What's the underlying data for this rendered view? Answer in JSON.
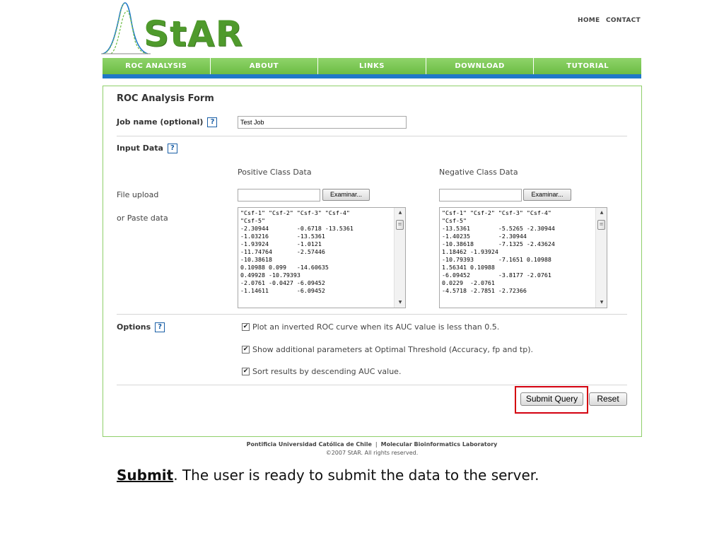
{
  "brand": {
    "logo_text": "StAR",
    "accent": "#6cbd44",
    "stripe": "#1f78c8"
  },
  "top_links": {
    "home": "HOME",
    "contact": "CONTACT"
  },
  "nav": [
    "ROC ANALYSIS",
    "ABOUT",
    "LINKS",
    "DOWNLOAD",
    "TUTORIAL"
  ],
  "form": {
    "title": "ROC Analysis Form",
    "job_name_label": "Job name (optional)",
    "job_name_value": "Test Job",
    "help_glyph": "?",
    "input_data_label": "Input Data",
    "positive_header": "Positive Class Data",
    "negative_header": "Negative Class Data",
    "file_upload_label": "File upload",
    "paste_label": "or Paste data",
    "browse_label": "Examinar...",
    "positive_paste": "\"Csf-1\" \"Csf-2\" \"Csf-3\" \"Csf-4\"\n\"Csf-5\"\n-2.30944        -0.6718 -13.5361\n-1.03216        -13.5361\n-1.93924        -1.0121\n-11.74764       -2.57446\n-10.38618\n0.10988 0.099   -14.60635\n0.49928 -10.79393\n-2.0761 -0.0427 -6.09452\n-1.14611        -6.09452",
    "negative_paste": "\"Csf-1\" \"Csf-2\" \"Csf-3\" \"Csf-4\"\n\"Csf-5\"\n-13.5361        -5.5265 -2.30944\n-1.40235        -2.30944\n-10.38618       -7.1325 -2.43624\n1.18462 -1.93924\n-10.79393       -7.1651 0.10988\n1.56341 0.10988\n-6.09452        -3.8177 -2.0761\n0.0229  -2.0761\n-4.5718 -2.7851 -2.72366",
    "options_label": "Options",
    "options": [
      {
        "label": "Plot an inverted ROC curve when its AUC value is less than 0.5.",
        "checked": true
      },
      {
        "label": "Show additional parameters at Optimal Threshold (Accuracy, fp and tp).",
        "checked": true
      },
      {
        "label": "Sort results by descending AUC value.",
        "checked": true
      }
    ],
    "check_glyph": "✔",
    "submit_label": "Submit Query",
    "reset_label": "Reset",
    "highlight_color": "#d4000f"
  },
  "footer": {
    "university": "Pontificia Universidad Católica de Chile",
    "separator": "|",
    "lab": "Molecular Bioinformatics Laboratory",
    "copyright": "©2007 StAR. All rights reserved."
  },
  "caption": {
    "bold": "Submit",
    "rest": ". The user is ready to submit the data to the server."
  }
}
